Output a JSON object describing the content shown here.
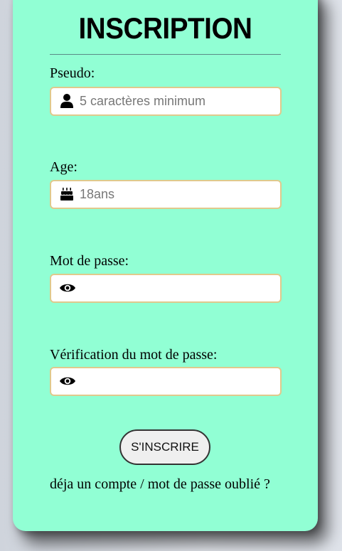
{
  "form": {
    "title": "INSCRIPTION",
    "pseudo": {
      "label": "Pseudo:",
      "placeholder": "5 caractères minimum",
      "icon": "user-icon"
    },
    "age": {
      "label": "Age:",
      "placeholder": "18ans",
      "icon": "birthday-cake-icon"
    },
    "password": {
      "label": "Mot de passe:",
      "placeholder": "",
      "icon": "eye-icon"
    },
    "password_confirm": {
      "label": "Vérification du mot de passe:",
      "placeholder": "",
      "icon": "eye-icon"
    },
    "submit_label": "S'INSCRIRE",
    "footer_link": "déja un compte / mot de passe oublié ?"
  },
  "colors": {
    "card_background": "#91ffd4",
    "field_border": "#e0c98c",
    "button_background": "#efefef"
  }
}
